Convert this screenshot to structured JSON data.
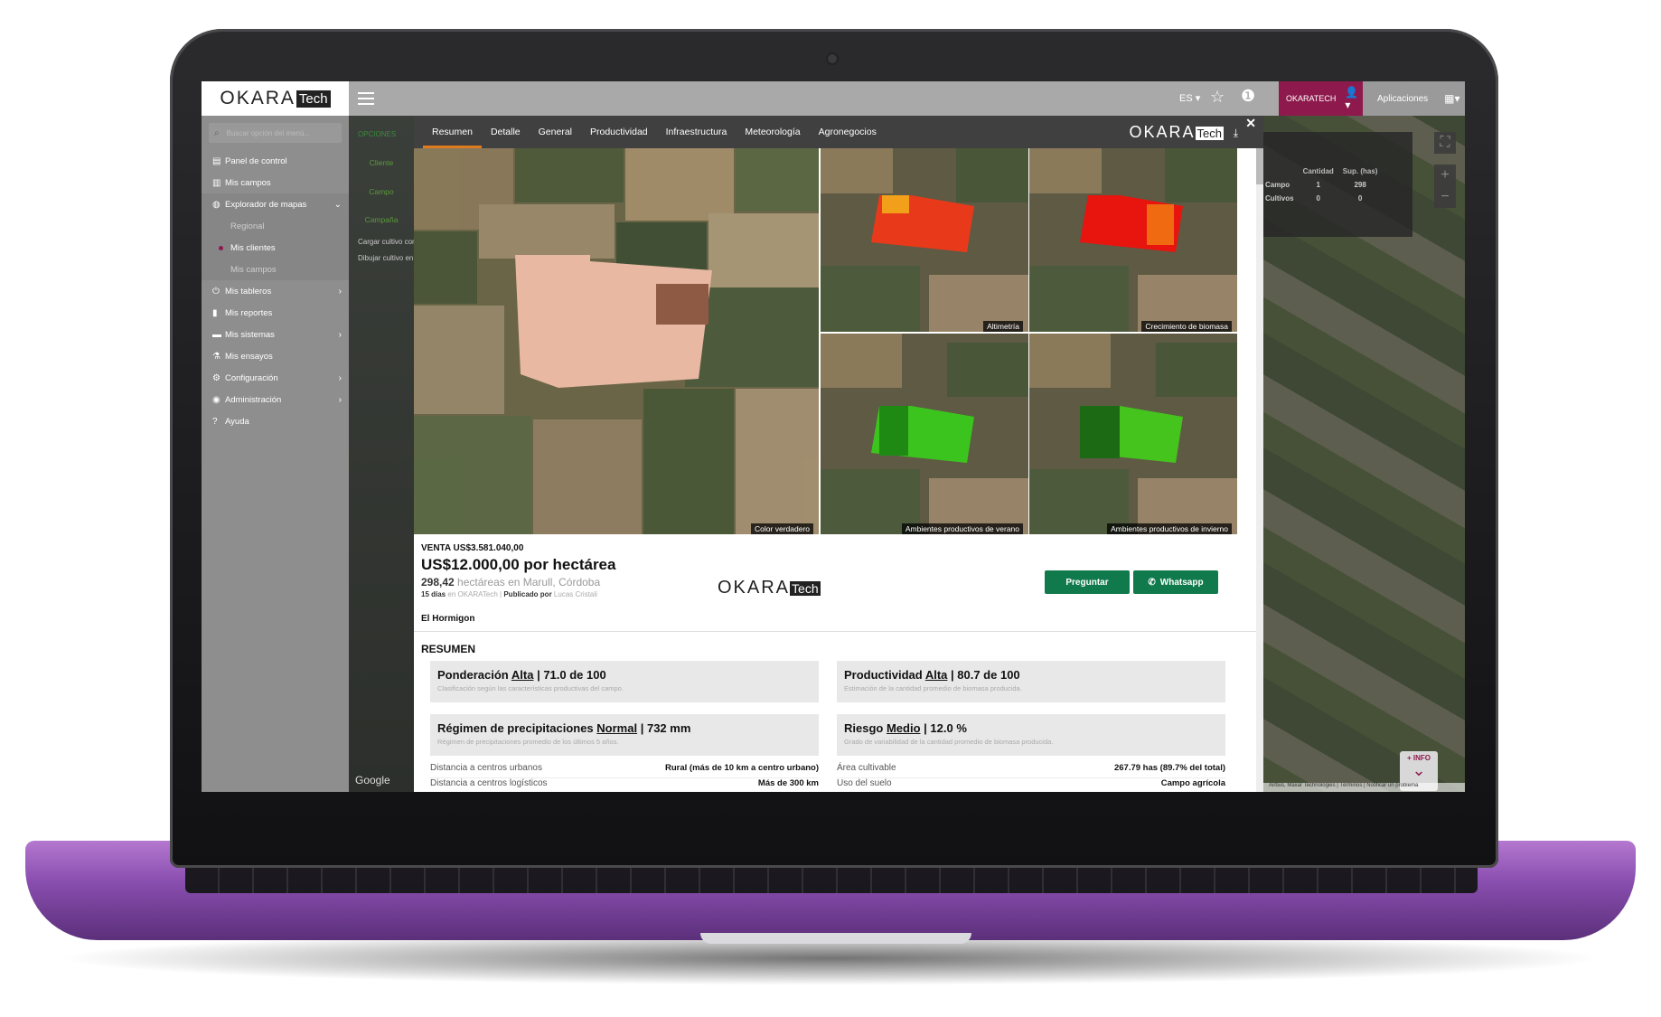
{
  "topbar": {
    "brand_main": "OKARA",
    "brand_tech": "Tech",
    "lang": "ES ▾",
    "user": "OKARATECH",
    "apps": "Aplicaciones"
  },
  "sidebar": {
    "search_placeholder": "Buscar opción del menú...",
    "items": [
      {
        "label": "Panel de control",
        "icon": "dashboard-icon"
      },
      {
        "label": "Mis campos",
        "icon": "map-icon"
      },
      {
        "label": "Explorador de mapas",
        "icon": "globe-icon"
      },
      {
        "label": "Regional"
      },
      {
        "label": "Mis clientes"
      },
      {
        "label": "Mis campos"
      },
      {
        "label": "Mis tableros",
        "icon": "power-icon"
      },
      {
        "label": "Mis reportes",
        "icon": "file-icon"
      },
      {
        "label": "Mis sistemas",
        "icon": "server-icon"
      },
      {
        "label": "Mis ensayos",
        "icon": "flask-icon"
      },
      {
        "label": "Configuración",
        "icon": "gear-icon"
      },
      {
        "label": "Administración",
        "icon": "user-circle-icon"
      },
      {
        "label": "Ayuda",
        "icon": "help-icon"
      }
    ]
  },
  "options_panel": {
    "title": "OPCIONES",
    "items": [
      "Cliente",
      "Campo",
      "Campaña"
    ],
    "actions": [
      "Cargar cultivo con",
      "Dibujar cultivo en"
    ],
    "google": "Google"
  },
  "map_stats": {
    "headers": [
      "",
      "Cantidad",
      "Sup. (has)"
    ],
    "rows": [
      [
        "Campo",
        "1",
        "298"
      ],
      [
        "Cultivos",
        "0",
        "0"
      ]
    ]
  },
  "map_controls": {
    "info_label": "+ INFO",
    "attribution": "Airbus, Maxar Technologies | Términos | Notificar un problema"
  },
  "modal": {
    "tabs": [
      "Resumen",
      "Detalle",
      "General",
      "Productividad",
      "Infraestructura",
      "Meteorología",
      "Agronegocios"
    ],
    "active_tab": "Resumen",
    "logo_main": "OKARA",
    "logo_tech": "Tech",
    "image_labels": {
      "main": "Color verdadero",
      "altimetria": "Altimetría",
      "biomasa": "Crecimiento de biomasa",
      "verano": "Ambientes productivos de verano",
      "invierno": "Ambientes productivos de invierno"
    },
    "colors": {
      "accent": "#e07a1e",
      "brand": "#8e1a4d",
      "button": "#117a4c"
    }
  },
  "listing": {
    "venta": "VENTA US$3.581.040,00",
    "price": "US$12.000,00 por hectárea",
    "hectares": "298,42",
    "location": "hectáreas en Marull, Córdoba",
    "days": "15 días",
    "on": "en OKARATech |",
    "published_by": "Publicado por",
    "author": "Lucas Cristali",
    "farm_name": "El Hormigon",
    "btn_ask": "Preguntar",
    "btn_whatsapp": "Whatsapp"
  },
  "summary": {
    "title": "RESUMEN",
    "cards": [
      {
        "pre": "Ponderación",
        "level": "Alta",
        "post": "| 71.0 de 100",
        "sub": "Clasificación según las características productivas del campo."
      },
      {
        "pre": "Productividad",
        "level": "Alta",
        "post": "| 80.7 de 100",
        "sub": "Estimación de la cantidad promedio de biomasa producida."
      },
      {
        "pre": "Régimen de precipitaciones",
        "level": "Normal",
        "post": "| 732 mm",
        "sub": "Régimen de precipitaciones promedio de los últimos 5 años."
      },
      {
        "pre": "Riesgo",
        "level": "Medio",
        "post": "| 12.0 %",
        "sub": "Grado de variabilidad de la cantidad promedio de biomasa producida."
      }
    ],
    "left_rows": [
      {
        "k": "Distancia a centros urbanos",
        "v": "Rural (más de 10 km a centro urbano)"
      },
      {
        "k": "Distancia a centros logísticos",
        "v": "Más de 300 km"
      }
    ],
    "right_rows": [
      {
        "k": "Área cultivable",
        "v": "267.79 has (89.7% del total)"
      },
      {
        "k": "Uso del suelo",
        "v": "Campo agrícola"
      }
    ]
  }
}
